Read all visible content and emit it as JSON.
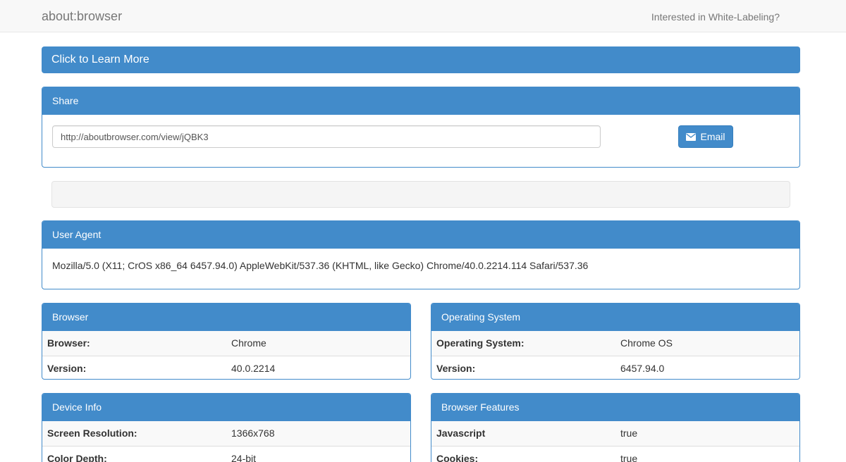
{
  "navbar": {
    "brand": "about:browser",
    "link": "Interested in White-Labeling?"
  },
  "learn_more": {
    "label": "Click to Learn More"
  },
  "share": {
    "title": "Share",
    "url_value": "http://aboutbrowser.com/view/jQBK3",
    "email_label": "Email",
    "email_icon": "envelope-icon"
  },
  "user_agent": {
    "title": "User Agent",
    "value": "Mozilla/5.0 (X11; CrOS x86_64 6457.94.0) AppleWebKit/537.36 (KHTML, like Gecko) Chrome/40.0.2214.114 Safari/537.36"
  },
  "browser": {
    "title": "Browser",
    "rows": [
      {
        "key": "Browser:",
        "value": "Chrome"
      },
      {
        "key": "Version:",
        "value": "40.0.2214"
      }
    ]
  },
  "os": {
    "title": "Operating System",
    "rows": [
      {
        "key": "Operating System:",
        "value": "Chrome OS"
      },
      {
        "key": "Version:",
        "value": "6457.94.0"
      }
    ]
  },
  "device": {
    "title": "Device Info",
    "rows": [
      {
        "key": "Screen Resolution:",
        "value": "1366x768"
      },
      {
        "key": "Color Depth:",
        "value": "24-bit"
      }
    ]
  },
  "features": {
    "title": "Browser Features",
    "rows": [
      {
        "key": "Javascript",
        "value": "true"
      },
      {
        "key": "Cookies:",
        "value": "true"
      }
    ]
  },
  "colors": {
    "primary": "#428bca",
    "navbar_bg": "#f8f8f8",
    "well_bg": "#f5f5f5"
  }
}
